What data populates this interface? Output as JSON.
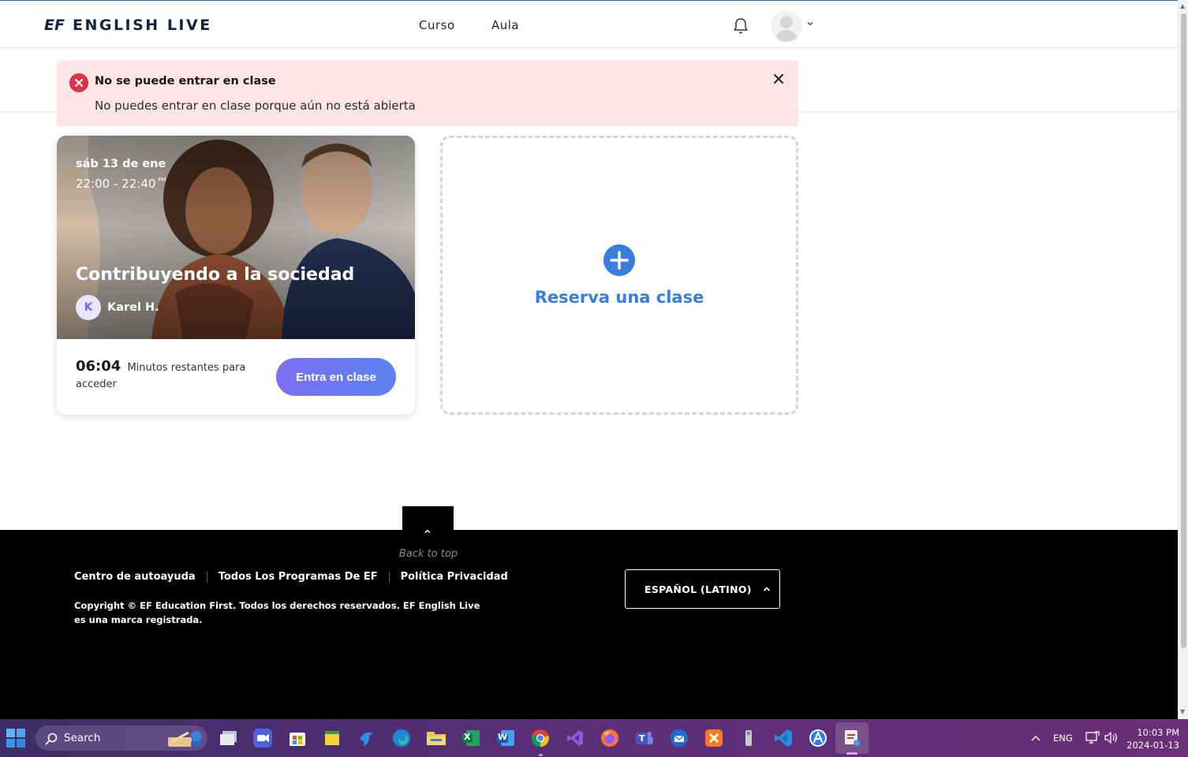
{
  "header": {
    "logo_mark": "EF",
    "logo_text": "ENGLISH LIVE",
    "nav": [
      {
        "label": "Curso"
      },
      {
        "label": "Aula"
      }
    ]
  },
  "alert": {
    "title": "No se puede entrar en clase",
    "message": "No puedes entrar en clase porque aún no está abierta",
    "type": "error",
    "color": "#d9334b",
    "background": "#fde4e7"
  },
  "class_card": {
    "date": "sáb 13 de ene",
    "time": "22:00 - 22:40",
    "time_suffix": "PM",
    "title": "Contribuyendo a la sociedad",
    "teacher_initial": "K",
    "teacher_name": "Karel H.",
    "countdown": "06:04",
    "countdown_text": "Minutos restantes para acceder",
    "enter_button": "Entra en clase",
    "button_colors": [
      "#7c6ff0",
      "#5a83f0"
    ]
  },
  "book_card": {
    "label": "Reserva una clase",
    "accent": "#3b7ddd"
  },
  "footer": {
    "back_to_top": "Back to top",
    "links": [
      {
        "label": "Centro de autoayuda"
      },
      {
        "label": "Todos Los Programas De EF"
      },
      {
        "label": "Política Privacidad"
      }
    ],
    "copyright": "Copyright © EF Education First. Todos los derechos reservados. EF English Live es una marca registrada.",
    "language": "ESPAÑOL (LATINO)"
  },
  "taskbar": {
    "search_label": "Search",
    "apps": [
      {
        "name": "file-explorer-window"
      },
      {
        "name": "zoom"
      },
      {
        "name": "microsoft-store"
      },
      {
        "name": "sticky-notes"
      },
      {
        "name": "dolphin-app"
      },
      {
        "name": "edge"
      },
      {
        "name": "file-explorer"
      },
      {
        "name": "excel",
        "text": "X"
      },
      {
        "name": "word",
        "text": "W"
      },
      {
        "name": "chrome"
      },
      {
        "name": "visual-studio"
      },
      {
        "name": "firefox"
      },
      {
        "name": "teams",
        "text": "T"
      },
      {
        "name": "thunderbird"
      },
      {
        "name": "xampp"
      },
      {
        "name": "usb-device"
      },
      {
        "name": "vscode"
      },
      {
        "name": "app-store"
      },
      {
        "name": "snipping-tool"
      }
    ],
    "language": "ENG",
    "time": "10:03 PM",
    "date": "2024-01-13"
  }
}
